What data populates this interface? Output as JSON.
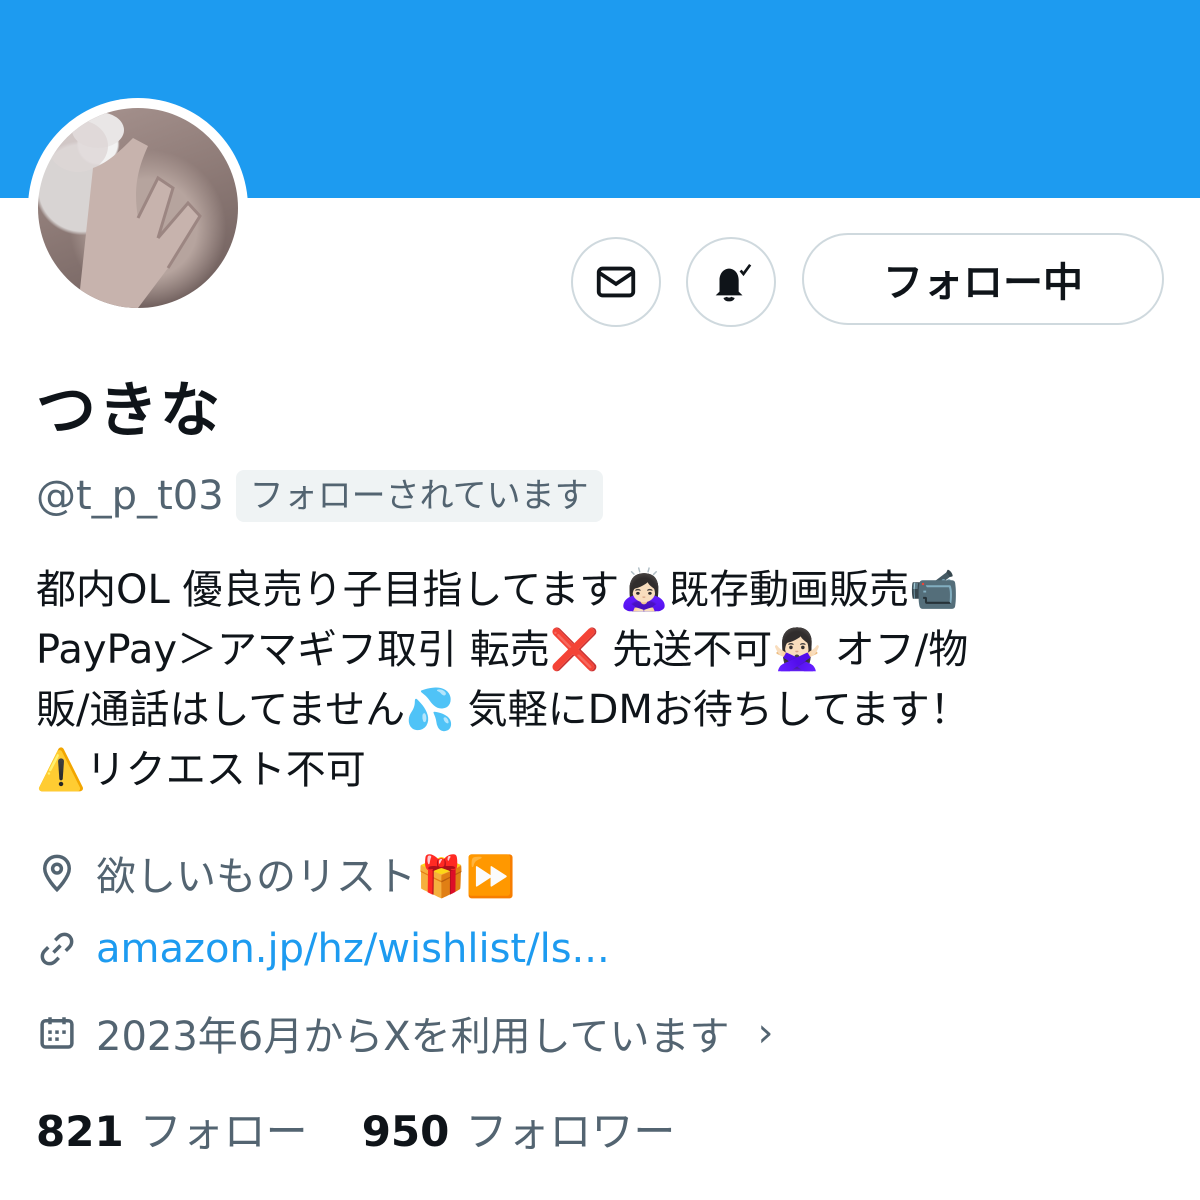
{
  "colors": {
    "banner": "#1d9bf0",
    "link": "#1d9bf0",
    "secondary": "#536471"
  },
  "profile": {
    "display_name": "つきな",
    "handle": "@t_p_t03",
    "follows_you_badge": "フォローされています",
    "bio_lines": [
      "都内OL 優良売り子目指してます🙇🏻‍♀️既存動画販売📹",
      "PayPay＞アマギフ取引 転売❌ 先送不可🙅🏻‍♀️ オフ/物",
      "販/通話はしてません💦 気軽にDMお待ちしてます！",
      "⚠️リクエスト不可"
    ],
    "location": "欲しいものリスト🎁⏩",
    "url": "amazon.jp/hz/wishlist/ls...",
    "joined": "2023年6月からXを利用しています",
    "icons": {
      "dm": "envelope-icon",
      "notify": "bell-check-icon",
      "location": "map-pin-icon",
      "url": "link-icon",
      "joined": "calendar-icon",
      "chevron": "chevron-right-icon"
    }
  },
  "actions": {
    "following_label": "フォロー中"
  },
  "stats": {
    "following_count": "821",
    "following_label": "フォロー",
    "followers_count": "950",
    "followers_label": "フォロワー"
  }
}
